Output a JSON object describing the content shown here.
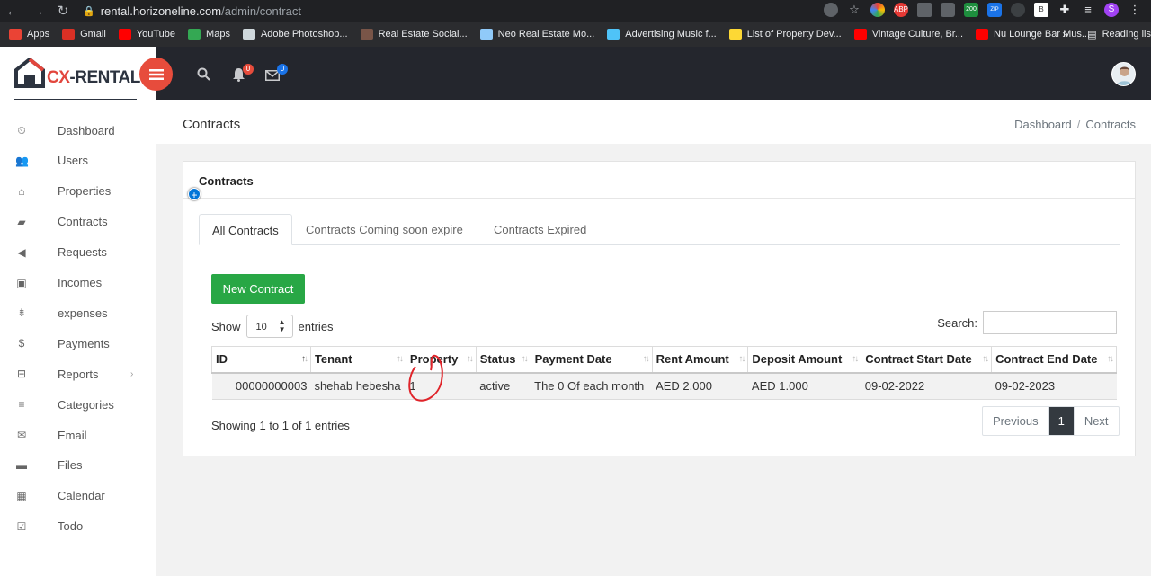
{
  "browser": {
    "url_host": "rental.horizoneline.com",
    "url_path": "/admin/contract",
    "ext_badge": "200",
    "profile_initial": "S",
    "bookmarks": [
      {
        "label": "Apps",
        "color": "#ea4335"
      },
      {
        "label": "Gmail",
        "color": "#d93025"
      },
      {
        "label": "YouTube",
        "color": "#ff0000"
      },
      {
        "label": "Maps",
        "color": "#34a853"
      },
      {
        "label": "Adobe Photoshop...",
        "color": "#cfd8dc"
      },
      {
        "label": "Real Estate Social...",
        "color": "#795548"
      },
      {
        "label": "Neo Real Estate Mo...",
        "color": "#90caf9"
      },
      {
        "label": "Advertising Music f...",
        "color": "#4fc3f7"
      },
      {
        "label": "List of Property Dev...",
        "color": "#fdd835"
      },
      {
        "label": "Vintage Culture, Br...",
        "color": "#ff0000"
      },
      {
        "label": "Nu Lounge Bar Mus...",
        "color": "#ff0000"
      }
    ],
    "more": "»",
    "reading_list": "Reading lis"
  },
  "header": {
    "logo_text_c": "CX",
    "logo_text_rest": "-RENTAL",
    "notifications_count": "0",
    "messages_count": "0"
  },
  "sidebar": {
    "items": [
      {
        "label": "Dashboard",
        "icon": "dashboard-icon",
        "glyph": "⏲"
      },
      {
        "label": "Users",
        "icon": "users-icon",
        "glyph": "👥"
      },
      {
        "label": "Properties",
        "icon": "home-icon",
        "glyph": "⌂"
      },
      {
        "label": "Contracts",
        "icon": "book-icon",
        "glyph": "▰"
      },
      {
        "label": "Requests",
        "icon": "megaphone-icon",
        "glyph": "◀"
      },
      {
        "label": "Incomes",
        "icon": "money-icon",
        "glyph": "▣"
      },
      {
        "label": "expenses",
        "icon": "sort-icon",
        "glyph": "⇟"
      },
      {
        "label": "Payments",
        "icon": "dollar-icon",
        "glyph": "$"
      },
      {
        "label": "Reports",
        "icon": "inbox-icon",
        "glyph": "⊟"
      },
      {
        "label": "Categories",
        "icon": "list-icon",
        "glyph": "≡"
      },
      {
        "label": "Email",
        "icon": "envelope-icon",
        "glyph": "✉"
      },
      {
        "label": "Files",
        "icon": "folder-icon",
        "glyph": "▬"
      },
      {
        "label": "Calendar",
        "icon": "calendar-icon",
        "glyph": "▦"
      },
      {
        "label": "Todo",
        "icon": "check-square-icon",
        "glyph": "☑"
      }
    ]
  },
  "page": {
    "title": "Contracts",
    "breadcrumb": [
      "Dashboard",
      "Contracts"
    ],
    "breadcrumb_sep": "/"
  },
  "card": {
    "title": "Contracts",
    "tabs": [
      "All Contracts",
      "Contracts Coming soon expire",
      "Contracts Expired"
    ],
    "new_button": "New Contract",
    "show_label": "Show",
    "show_value": "10",
    "entries_label": "entries",
    "search_label": "Search:",
    "columns": [
      "ID",
      "Tenant",
      "Property",
      "Status",
      "Payment Date",
      "Rent Amount",
      "Deposit Amount",
      "Contract Start Date",
      "Contract End Date"
    ],
    "rows": [
      [
        "00000000003",
        "shehab hebesha",
        "1",
        "active",
        "The 0 Of each month",
        "AED 2.000",
        "AED 1.000",
        "09-02-2022",
        "09-02-2023"
      ]
    ],
    "info": "Showing 1 to 1 of 1 entries",
    "pagination": {
      "previous": "Previous",
      "current": "1",
      "next": "Next"
    }
  },
  "colors": {
    "accent_red": "#e74c3c",
    "success": "#28a745",
    "header_dark": "#24262d"
  }
}
